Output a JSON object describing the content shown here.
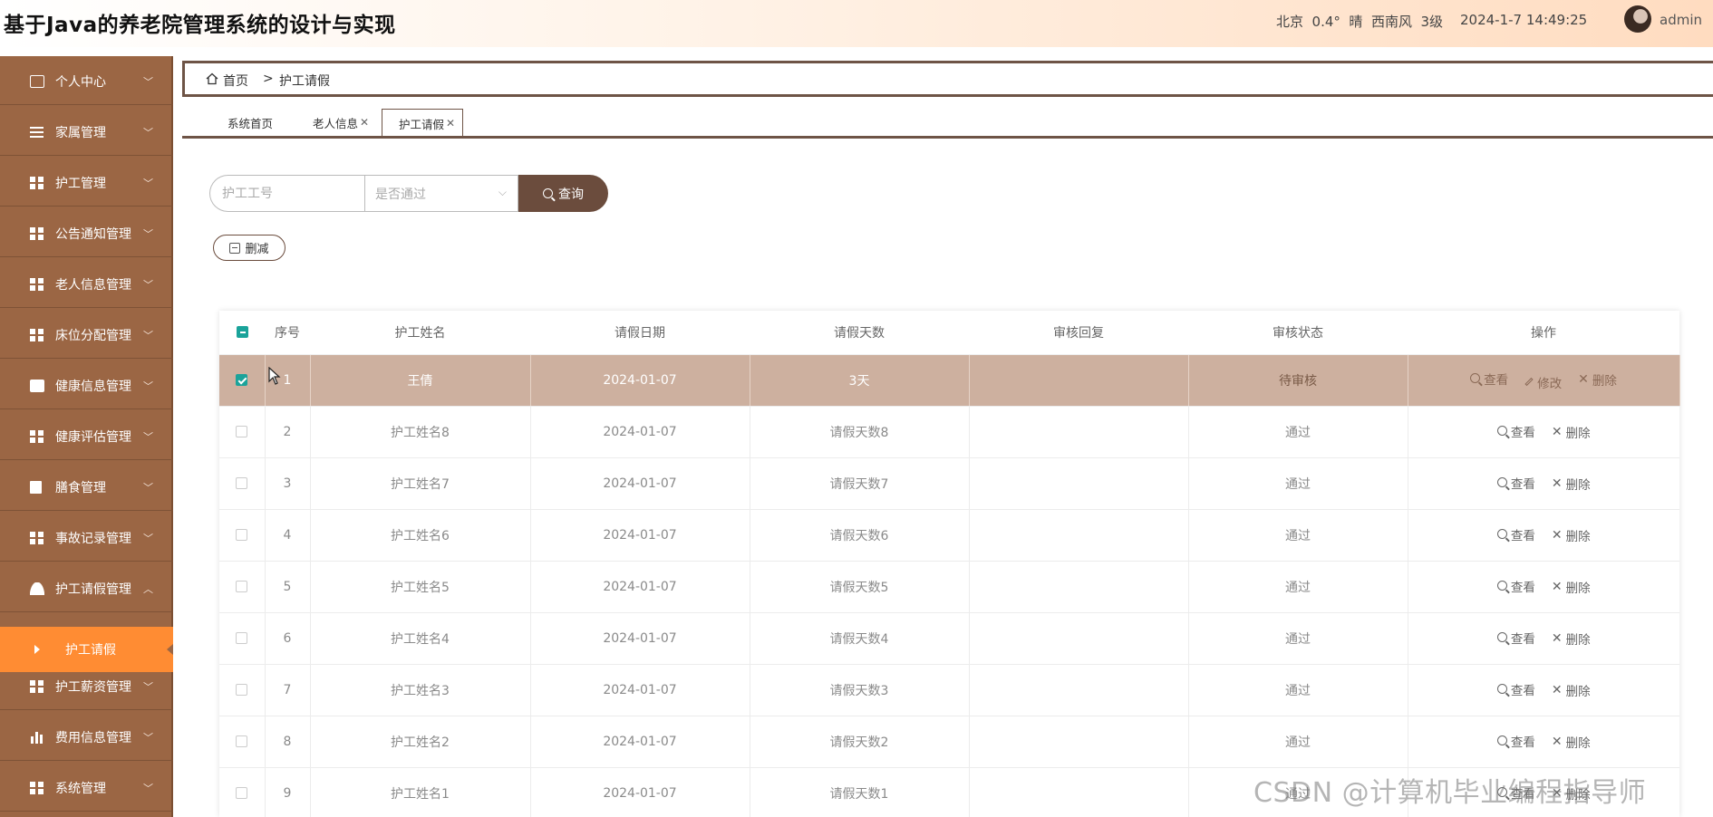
{
  "header": {
    "title": "基于Java的养老院管理系统的设计与实现",
    "weather": "北京  0.4°  晴  西南风  3级",
    "datetime": "2024-1-7 14:49:25",
    "username": "admin"
  },
  "sidebar": {
    "items": [
      {
        "label": "个人中心",
        "icon": "card-icon"
      },
      {
        "label": "家属管理",
        "icon": "list-icon"
      },
      {
        "label": "护工管理",
        "icon": "grid-icon"
      },
      {
        "label": "公告通知管理",
        "icon": "grid-icon"
      },
      {
        "label": "老人信息管理",
        "icon": "grid-icon"
      },
      {
        "label": "床位分配管理",
        "icon": "grid-icon"
      },
      {
        "label": "健康信息管理",
        "icon": "briefcase-icon"
      },
      {
        "label": "健康评估管理",
        "icon": "grid-icon"
      },
      {
        "label": "膳食管理",
        "icon": "clipboard-icon"
      },
      {
        "label": "事故记录管理",
        "icon": "grid-icon"
      },
      {
        "label": "护工请假管理",
        "icon": "user-icon"
      },
      {
        "label": "护工薪资管理",
        "icon": "grid-icon"
      },
      {
        "label": "费用信息管理",
        "icon": "bar-chart-icon"
      },
      {
        "label": "系统管理",
        "icon": "grid-icon"
      }
    ],
    "sub_item": "护工请假"
  },
  "breadcrumb": {
    "home": "首页",
    "separator": ">",
    "current": "护工请假"
  },
  "tabs": [
    {
      "label": "系统首页",
      "closable": false
    },
    {
      "label": "老人信息",
      "closable": true
    },
    {
      "label": "护工请假",
      "closable": true
    }
  ],
  "search": {
    "worker_no_placeholder": "护工工号",
    "approved_placeholder": "是否通过",
    "query_label": "查询"
  },
  "toolbar": {
    "delete_label": "删减"
  },
  "table": {
    "headers": [
      "序号",
      "护工姓名",
      "请假日期",
      "请假天数",
      "审核回复",
      "审核状态",
      "操作"
    ],
    "actions": {
      "view": "查看",
      "edit": "修改",
      "delete": "删除"
    },
    "rows": [
      {
        "no": "1",
        "name": "王倩",
        "date": "2024-01-07",
        "days": "3天",
        "reply": "",
        "status": "待审核"
      },
      {
        "no": "2",
        "name": "护工姓名8",
        "date": "2024-01-07",
        "days": "请假天数8",
        "reply": "",
        "status": "通过"
      },
      {
        "no": "3",
        "name": "护工姓名7",
        "date": "2024-01-07",
        "days": "请假天数7",
        "reply": "",
        "status": "通过"
      },
      {
        "no": "4",
        "name": "护工姓名6",
        "date": "2024-01-07",
        "days": "请假天数6",
        "reply": "",
        "status": "通过"
      },
      {
        "no": "5",
        "name": "护工姓名5",
        "date": "2024-01-07",
        "days": "请假天数5",
        "reply": "",
        "status": "通过"
      },
      {
        "no": "6",
        "name": "护工姓名4",
        "date": "2024-01-07",
        "days": "请假天数4",
        "reply": "",
        "status": "通过"
      },
      {
        "no": "7",
        "name": "护工姓名3",
        "date": "2024-01-07",
        "days": "请假天数3",
        "reply": "",
        "status": "通过"
      },
      {
        "no": "8",
        "name": "护工姓名2",
        "date": "2024-01-07",
        "days": "请假天数2",
        "reply": "",
        "status": "通过"
      },
      {
        "no": "9",
        "name": "护工姓名1",
        "date": "2024-01-07",
        "days": "请假天数1",
        "reply": "",
        "status": "通过"
      }
    ]
  },
  "watermark": "CSDN @计算机毕业编程指导师"
}
